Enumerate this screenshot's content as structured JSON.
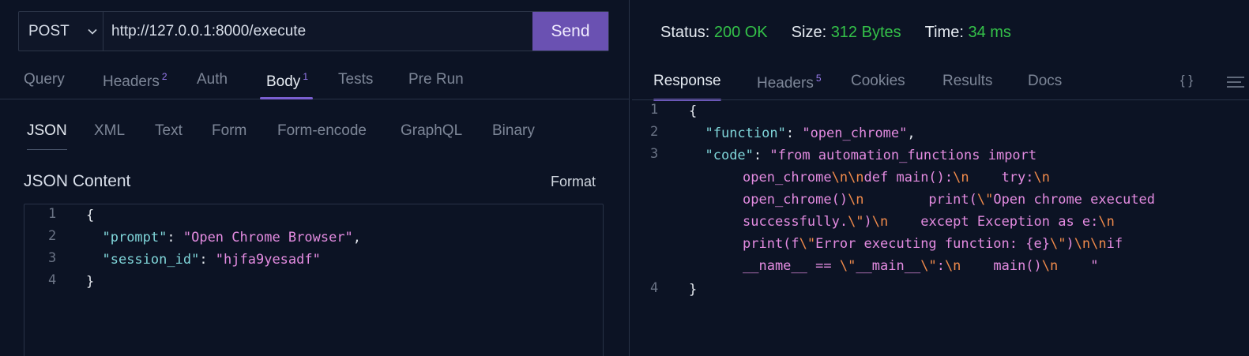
{
  "request": {
    "method": "POST",
    "url": "http://127.0.0.1:8000/execute",
    "send_label": "Send"
  },
  "tabs": [
    {
      "label": "Query",
      "badge": ""
    },
    {
      "label": "Headers",
      "badge": "2"
    },
    {
      "label": "Auth",
      "badge": ""
    },
    {
      "label": "Body",
      "badge": "1",
      "active": true
    },
    {
      "label": "Tests",
      "badge": ""
    },
    {
      "label": "Pre Run",
      "badge": ""
    }
  ],
  "body_tabs": [
    {
      "label": "JSON",
      "active": true
    },
    {
      "label": "XML"
    },
    {
      "label": "Text"
    },
    {
      "label": "Form"
    },
    {
      "label": "Form-encode"
    },
    {
      "label": "GraphQL"
    },
    {
      "label": "Binary"
    }
  ],
  "body_editor": {
    "title": "JSON Content",
    "format_label": "Format",
    "line_numbers": [
      "1",
      "2",
      "3",
      "4"
    ],
    "open_brace": "{",
    "close_brace": "}",
    "fields": [
      {
        "key": "\"prompt\"",
        "value": "\"Open Chrome Browser\"",
        "comma": ","
      },
      {
        "key": "\"session_id\"",
        "value": "\"hjfa9yesadf\"",
        "comma": ""
      }
    ]
  },
  "response": {
    "status_label": "Status:",
    "status_value": "200 OK",
    "size_label": "Size:",
    "size_value": "312 Bytes",
    "time_label": "Time:",
    "time_value": "34 ms",
    "tabs": [
      {
        "label": "Response",
        "badge": "",
        "active": true
      },
      {
        "label": "Headers",
        "badge": "5"
      },
      {
        "label": "Cookies",
        "badge": ""
      },
      {
        "label": "Results",
        "badge": ""
      },
      {
        "label": "Docs",
        "badge": ""
      }
    ],
    "braces_icon_label": "{ }",
    "line_numbers": [
      "1",
      "2",
      "3",
      "4"
    ],
    "open_brace": "{",
    "close_brace": "}",
    "function_key": "\"function\"",
    "function_value": "\"open_chrome\"",
    "code_key": "\"code\"",
    "code_lines": [
      [
        {
          "t": "s",
          "v": "\"from automation_functions import"
        }
      ],
      [
        {
          "t": "s",
          "v": "open_chrome"
        },
        {
          "t": "e",
          "v": "\\n\\n"
        },
        {
          "t": "s",
          "v": "def main():"
        },
        {
          "t": "e",
          "v": "\\n"
        },
        {
          "t": "s",
          "v": "    try:"
        },
        {
          "t": "e",
          "v": "\\n"
        }
      ],
      [
        {
          "t": "s",
          "v": "open_chrome()"
        },
        {
          "t": "e",
          "v": "\\n"
        },
        {
          "t": "s",
          "v": "        print("
        },
        {
          "t": "e",
          "v": "\\\""
        },
        {
          "t": "s",
          "v": "Open chrome executed"
        }
      ],
      [
        {
          "t": "s",
          "v": "successfully."
        },
        {
          "t": "e",
          "v": "\\\""
        },
        {
          "t": "s",
          "v": ")"
        },
        {
          "t": "e",
          "v": "\\n"
        },
        {
          "t": "s",
          "v": "    except Exception as e:"
        },
        {
          "t": "e",
          "v": "\\n"
        }
      ],
      [
        {
          "t": "s",
          "v": "print(f"
        },
        {
          "t": "e",
          "v": "\\\""
        },
        {
          "t": "s",
          "v": "Error executing function: {e}"
        },
        {
          "t": "e",
          "v": "\\\""
        },
        {
          "t": "s",
          "v": ")"
        },
        {
          "t": "e",
          "v": "\\n\\n"
        },
        {
          "t": "s",
          "v": "if"
        }
      ],
      [
        {
          "t": "s",
          "v": "__name__ == "
        },
        {
          "t": "e",
          "v": "\\\""
        },
        {
          "t": "s",
          "v": "__main__"
        },
        {
          "t": "e",
          "v": "\\\""
        },
        {
          "t": "s",
          "v": ":"
        },
        {
          "t": "e",
          "v": "\\n"
        },
        {
          "t": "s",
          "v": "    main()"
        },
        {
          "t": "e",
          "v": "\\n"
        },
        {
          "t": "s",
          "v": "    \""
        }
      ]
    ]
  }
}
